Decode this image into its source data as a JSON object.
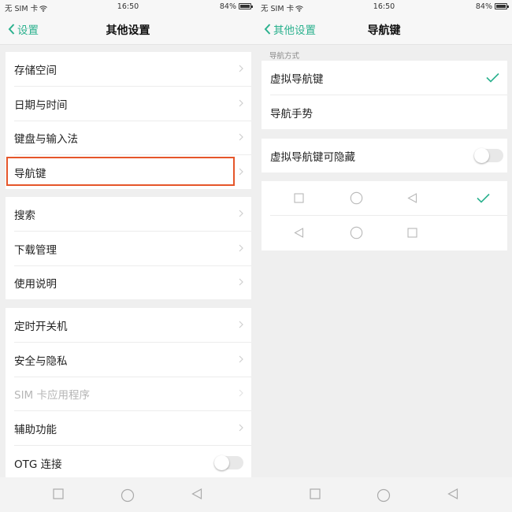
{
  "left": {
    "status": {
      "carrier": "无 SIM 卡",
      "time": "16:50",
      "battery": "84%",
      "battery_level": 0.84
    },
    "nav": {
      "back_label": "设置",
      "title": "其他设置"
    },
    "groups": [
      [
        "存储空间",
        "日期与时间",
        "键盘与输入法",
        "导航键"
      ],
      [
        "搜索",
        "下载管理",
        "使用说明"
      ],
      [
        "定时开关机",
        "安全与隐私",
        "SIM 卡应用程序",
        "辅助功能",
        "OTG 连接"
      ]
    ],
    "highlighted_item": "导航键",
    "disabled_item": "SIM 卡应用程序",
    "otg_toggle_on": false
  },
  "right": {
    "status": {
      "carrier": "无 SIM 卡",
      "time": "16:50",
      "battery": "84%",
      "battery_level": 0.84
    },
    "nav": {
      "back_label": "其他设置",
      "title": "导航键"
    },
    "section_label": "导航方式",
    "nav_modes": [
      "虚拟导航键",
      "导航手势"
    ],
    "selected_mode": "虚拟导航键",
    "hide_toggle_label": "虚拟导航键可隐藏",
    "hide_toggle_on": false,
    "layouts": [
      {
        "keys": [
          "square-icon",
          "circle-icon",
          "triangle-left-icon"
        ],
        "selected": true
      },
      {
        "keys": [
          "triangle-left-icon",
          "circle-icon",
          "square-icon"
        ],
        "selected": false
      }
    ]
  },
  "navkeys": [
    "square-icon",
    "circle-icon",
    "triangle-left-icon"
  ],
  "colors": {
    "accent": "#2bb18e",
    "highlight": "#e5562a",
    "background": "#efefef"
  }
}
